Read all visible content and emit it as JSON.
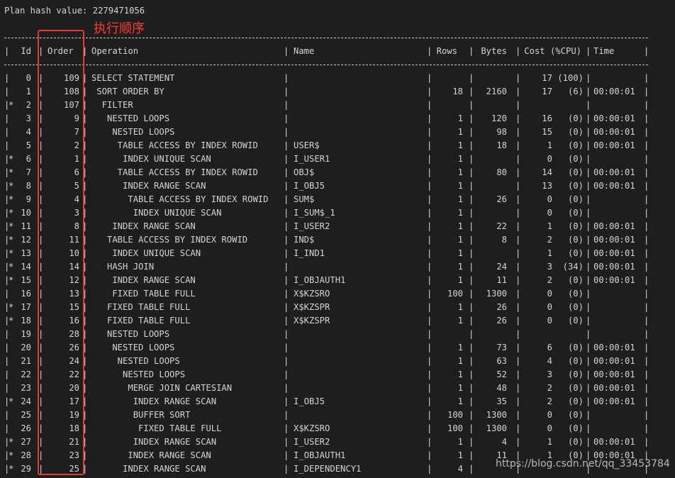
{
  "plan_hash_line": "Plan hash value: 2279471056",
  "annotation": "执行顺序",
  "watermark": "https://blog.csdn.net/qq_33453784",
  "headers": {
    "id": "Id",
    "order": "Order",
    "operation": "Operation",
    "name": "Name",
    "rows": "Rows",
    "bytes": "Bytes",
    "cost": "Cost (%CPU)",
    "time": "Time"
  },
  "rows": [
    {
      "star": " ",
      "id": "0",
      "order": "109",
      "op": "SELECT STATEMENT",
      "name": "",
      "rows": "",
      "bytes": "",
      "cost": "17 (100)",
      "time": ""
    },
    {
      "star": " ",
      "id": "1",
      "order": "108",
      "op": " SORT ORDER BY",
      "name": "",
      "rows": "18",
      "bytes": "2160",
      "cost": "17   (6)",
      "time": "00:00:01"
    },
    {
      "star": "*",
      "id": "2",
      "order": "107",
      "op": "  FILTER",
      "name": "",
      "rows": "",
      "bytes": "",
      "cost": "",
      "time": ""
    },
    {
      "star": " ",
      "id": "3",
      "order": "9",
      "op": "   NESTED LOOPS",
      "name": "",
      "rows": "1",
      "bytes": "120",
      "cost": "16   (0)",
      "time": "00:00:01"
    },
    {
      "star": " ",
      "id": "4",
      "order": "7",
      "op": "    NESTED LOOPS",
      "name": "",
      "rows": "1",
      "bytes": "98",
      "cost": "15   (0)",
      "time": "00:00:01"
    },
    {
      "star": " ",
      "id": "5",
      "order": "2",
      "op": "     TABLE ACCESS BY INDEX ROWID",
      "name": "USER$",
      "rows": "1",
      "bytes": "18",
      "cost": "1   (0)",
      "time": "00:00:01"
    },
    {
      "star": "*",
      "id": "6",
      "order": "1",
      "op": "      INDEX UNIQUE SCAN",
      "name": "I_USER1",
      "rows": "1",
      "bytes": "",
      "cost": "0   (0)",
      "time": ""
    },
    {
      "star": "*",
      "id": "7",
      "order": "6",
      "op": "     TABLE ACCESS BY INDEX ROWID",
      "name": "OBJ$",
      "rows": "1",
      "bytes": "80",
      "cost": "14   (0)",
      "time": "00:00:01"
    },
    {
      "star": "*",
      "id": "8",
      "order": "5",
      "op": "      INDEX RANGE SCAN",
      "name": "I_OBJ5",
      "rows": "1",
      "bytes": "",
      "cost": "13   (0)",
      "time": "00:00:01"
    },
    {
      "star": "*",
      "id": "9",
      "order": "4",
      "op": "       TABLE ACCESS BY INDEX ROWID",
      "name": "SUM$",
      "rows": "1",
      "bytes": "26",
      "cost": "0   (0)",
      "time": ""
    },
    {
      "star": "*",
      "id": "10",
      "order": "3",
      "op": "        INDEX UNIQUE SCAN",
      "name": "I_SUM$_1",
      "rows": "1",
      "bytes": "",
      "cost": "0   (0)",
      "time": ""
    },
    {
      "star": "*",
      "id": "11",
      "order": "8",
      "op": "    INDEX RANGE SCAN",
      "name": "I_USER2",
      "rows": "1",
      "bytes": "22",
      "cost": "1   (0)",
      "time": "00:00:01"
    },
    {
      "star": "*",
      "id": "12",
      "order": "11",
      "op": "   TABLE ACCESS BY INDEX ROWID",
      "name": "IND$",
      "rows": "1",
      "bytes": "8",
      "cost": "2   (0)",
      "time": "00:00:01"
    },
    {
      "star": "*",
      "id": "13",
      "order": "10",
      "op": "    INDEX UNIQUE SCAN",
      "name": "I_IND1",
      "rows": "1",
      "bytes": "",
      "cost": "1   (0)",
      "time": "00:00:01"
    },
    {
      "star": "*",
      "id": "14",
      "order": "14",
      "op": "   HASH JOIN",
      "name": "",
      "rows": "1",
      "bytes": "24",
      "cost": "3  (34)",
      "time": "00:00:01"
    },
    {
      "star": "*",
      "id": "15",
      "order": "12",
      "op": "    INDEX RANGE SCAN",
      "name": "I_OBJAUTH1",
      "rows": "1",
      "bytes": "11",
      "cost": "2   (0)",
      "time": "00:00:01"
    },
    {
      "star": " ",
      "id": "16",
      "order": "13",
      "op": "    FIXED TABLE FULL",
      "name": "X$KZSRO",
      "rows": "100",
      "bytes": "1300",
      "cost": "0   (0)",
      "time": ""
    },
    {
      "star": "*",
      "id": "17",
      "order": "15",
      "op": "   FIXED TABLE FULL",
      "name": "X$KZSPR",
      "rows": "1",
      "bytes": "26",
      "cost": "0   (0)",
      "time": ""
    },
    {
      "star": "*",
      "id": "18",
      "order": "16",
      "op": "   FIXED TABLE FULL",
      "name": "X$KZSPR",
      "rows": "1",
      "bytes": "26",
      "cost": "0   (0)",
      "time": ""
    },
    {
      "star": " ",
      "id": "19",
      "order": "28",
      "op": "   NESTED LOOPS",
      "name": "",
      "rows": "",
      "bytes": "",
      "cost": "",
      "time": ""
    },
    {
      "star": " ",
      "id": "20",
      "order": "26",
      "op": "    NESTED LOOPS",
      "name": "",
      "rows": "1",
      "bytes": "73",
      "cost": "6   (0)",
      "time": "00:00:01"
    },
    {
      "star": " ",
      "id": "21",
      "order": "24",
      "op": "     NESTED LOOPS",
      "name": "",
      "rows": "1",
      "bytes": "63",
      "cost": "4   (0)",
      "time": "00:00:01"
    },
    {
      "star": " ",
      "id": "22",
      "order": "22",
      "op": "      NESTED LOOPS",
      "name": "",
      "rows": "1",
      "bytes": "52",
      "cost": "3   (0)",
      "time": "00:00:01"
    },
    {
      "star": " ",
      "id": "23",
      "order": "20",
      "op": "       MERGE JOIN CARTESIAN",
      "name": "",
      "rows": "1",
      "bytes": "48",
      "cost": "2   (0)",
      "time": "00:00:01"
    },
    {
      "star": "*",
      "id": "24",
      "order": "17",
      "op": "        INDEX RANGE SCAN",
      "name": "I_OBJ5",
      "rows": "1",
      "bytes": "35",
      "cost": "2   (0)",
      "time": "00:00:01"
    },
    {
      "star": " ",
      "id": "25",
      "order": "19",
      "op": "        BUFFER SORT",
      "name": "",
      "rows": "100",
      "bytes": "1300",
      "cost": "0   (0)",
      "time": ""
    },
    {
      "star": " ",
      "id": "26",
      "order": "18",
      "op": "         FIXED TABLE FULL",
      "name": "X$KZSRO",
      "rows": "100",
      "bytes": "1300",
      "cost": "0   (0)",
      "time": ""
    },
    {
      "star": "*",
      "id": "27",
      "order": "21",
      "op": "        INDEX RANGE SCAN",
      "name": "I_USER2",
      "rows": "1",
      "bytes": "4",
      "cost": "1   (0)",
      "time": "00:00:01"
    },
    {
      "star": "*",
      "id": "28",
      "order": "23",
      "op": "       INDEX RANGE SCAN",
      "name": "I_OBJAUTH1",
      "rows": "1",
      "bytes": "11",
      "cost": "1   (0)",
      "time": "00:00:01"
    },
    {
      "star": "*",
      "id": "29",
      "order": "25",
      "op": "      INDEX RANGE SCAN",
      "name": "I_DEPENDENCY1",
      "rows": "4",
      "bytes": "",
      "cost": "",
      "time": ""
    }
  ]
}
